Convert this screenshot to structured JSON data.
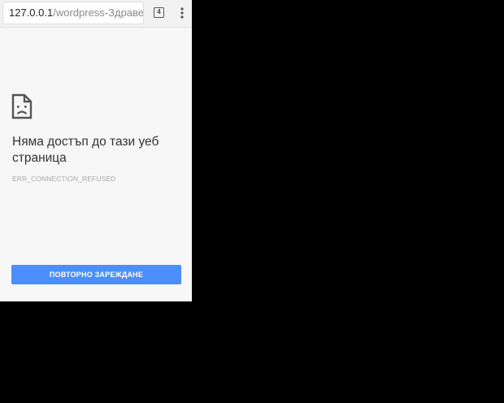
{
  "browser": {
    "url_host": "127.0.0.1",
    "url_path": "/wordpress-Здравец-з",
    "tab_count": "4",
    "menu_icon": "overflow-menu-icon"
  },
  "error_page": {
    "icon": "sad-document-icon",
    "title": "Няма достъп до тази уеб страница",
    "code": "ERR_CONNECTION_REFUSED",
    "reload_label": "ПОВТОРНО ЗАРЕЖДАНЕ"
  },
  "colors": {
    "page_background": "#f7f7f7",
    "button_blue": "#4c8efa",
    "outside_background": "#000000"
  }
}
